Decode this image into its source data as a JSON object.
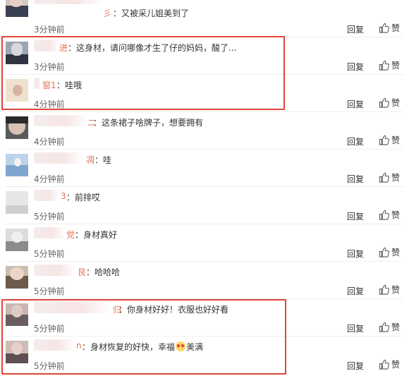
{
  "ui": {
    "reply_label": "回复",
    "like_label": "赞"
  },
  "comments": [
    {
      "nick": "彡",
      "text": "：又被采儿姐美到了",
      "time": "3分钟前"
    },
    {
      "nick": "进",
      "text": "：这身材，请问哪像才生了仔的妈妈，酸了...",
      "time": "3分钟前"
    },
    {
      "nick": "窗1",
      "text": "：哇哦",
      "time": "4分钟前"
    },
    {
      "nick": "ニ",
      "text": "：这条裙子啥牌子，想要拥有",
      "time": "4分钟前"
    },
    {
      "nick": "凋",
      "text": "：哇",
      "time": "4分钟前"
    },
    {
      "nick": "3",
      "text": "：前排哎",
      "time": "5分钟前"
    },
    {
      "nick": "党",
      "text": "：身材真好",
      "time": "5分钟前"
    },
    {
      "nick": "艮",
      "text": "：哈哈哈",
      "time": "5分钟前"
    },
    {
      "nick": "归",
      "text": "：你身材好好！衣服也好好看",
      "time": "5分钟前"
    },
    {
      "nick": "n",
      "text_before": "：身材恢复的好快，幸福",
      "emoji": "heart-eyes-emoji",
      "text_after": "美满",
      "time": "5分钟前"
    }
  ],
  "colors": {
    "nick": "#eb7350",
    "highlight_border": "#e0453a",
    "divider": "#eeeeee",
    "time": "#666666"
  }
}
